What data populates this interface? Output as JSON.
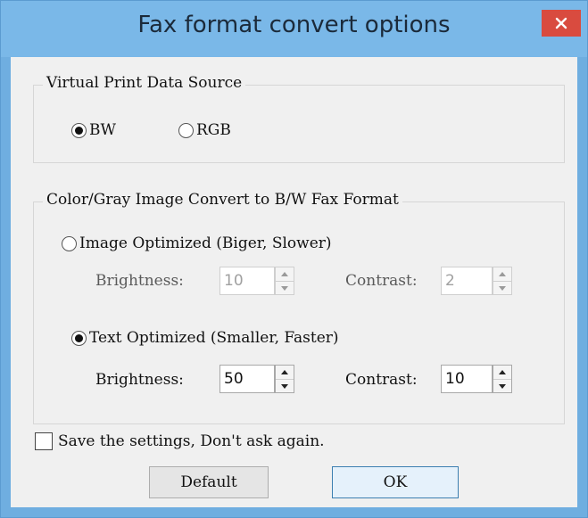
{
  "window": {
    "title": "Fax format convert options",
    "close_icon": "close-icon"
  },
  "source_group": {
    "title": "Virtual Print Data Source",
    "options": [
      {
        "label": "BW",
        "selected": true
      },
      {
        "label": "RGB",
        "selected": false
      }
    ]
  },
  "convert_group": {
    "title": "Color/Gray Image Convert to B/W Fax Format",
    "image_optimized": {
      "label": "Image Optimized (Biger, Slower)",
      "selected": false,
      "brightness_label": "Brightness:",
      "brightness_value": "10",
      "contrast_label": "Contrast:",
      "contrast_value": "2",
      "enabled": false
    },
    "text_optimized": {
      "label": "Text Optimized (Smaller, Faster)",
      "selected": true,
      "brightness_label": "Brightness:",
      "brightness_value": "50",
      "contrast_label": "Contrast:",
      "contrast_value": "10",
      "enabled": true
    }
  },
  "save_settings": {
    "label": "Save the settings, Don't ask again.",
    "checked": false
  },
  "buttons": {
    "default_label": "Default",
    "ok_label": "OK"
  },
  "colors": {
    "titlebar": "#7ab8e8",
    "close_button": "#d94b3f",
    "client_bg": "#f0f0f0"
  }
}
